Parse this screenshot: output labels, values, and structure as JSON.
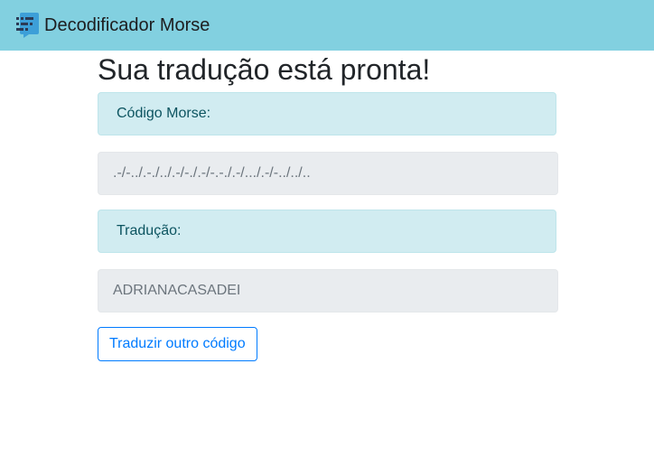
{
  "navbar": {
    "icon": "morse-chat-icon",
    "title": "Decodificador Morse",
    "background_color": "#82d0e0"
  },
  "main": {
    "heading": "Sua tradução está pronta!",
    "morse_label": "Código Morse:",
    "morse_value": ".-/-../.-./../.-/-./.-/-.-./.-/.../.-/-../../..",
    "translation_label": "Tradução:",
    "translation_value": "ADRIANACASADEI",
    "translate_again_button": "Traduzir outro código"
  },
  "colors": {
    "info_background": "#d1ecf1",
    "info_text": "#0c5460",
    "field_background": "#e9ecef",
    "primary": "#007bff"
  }
}
